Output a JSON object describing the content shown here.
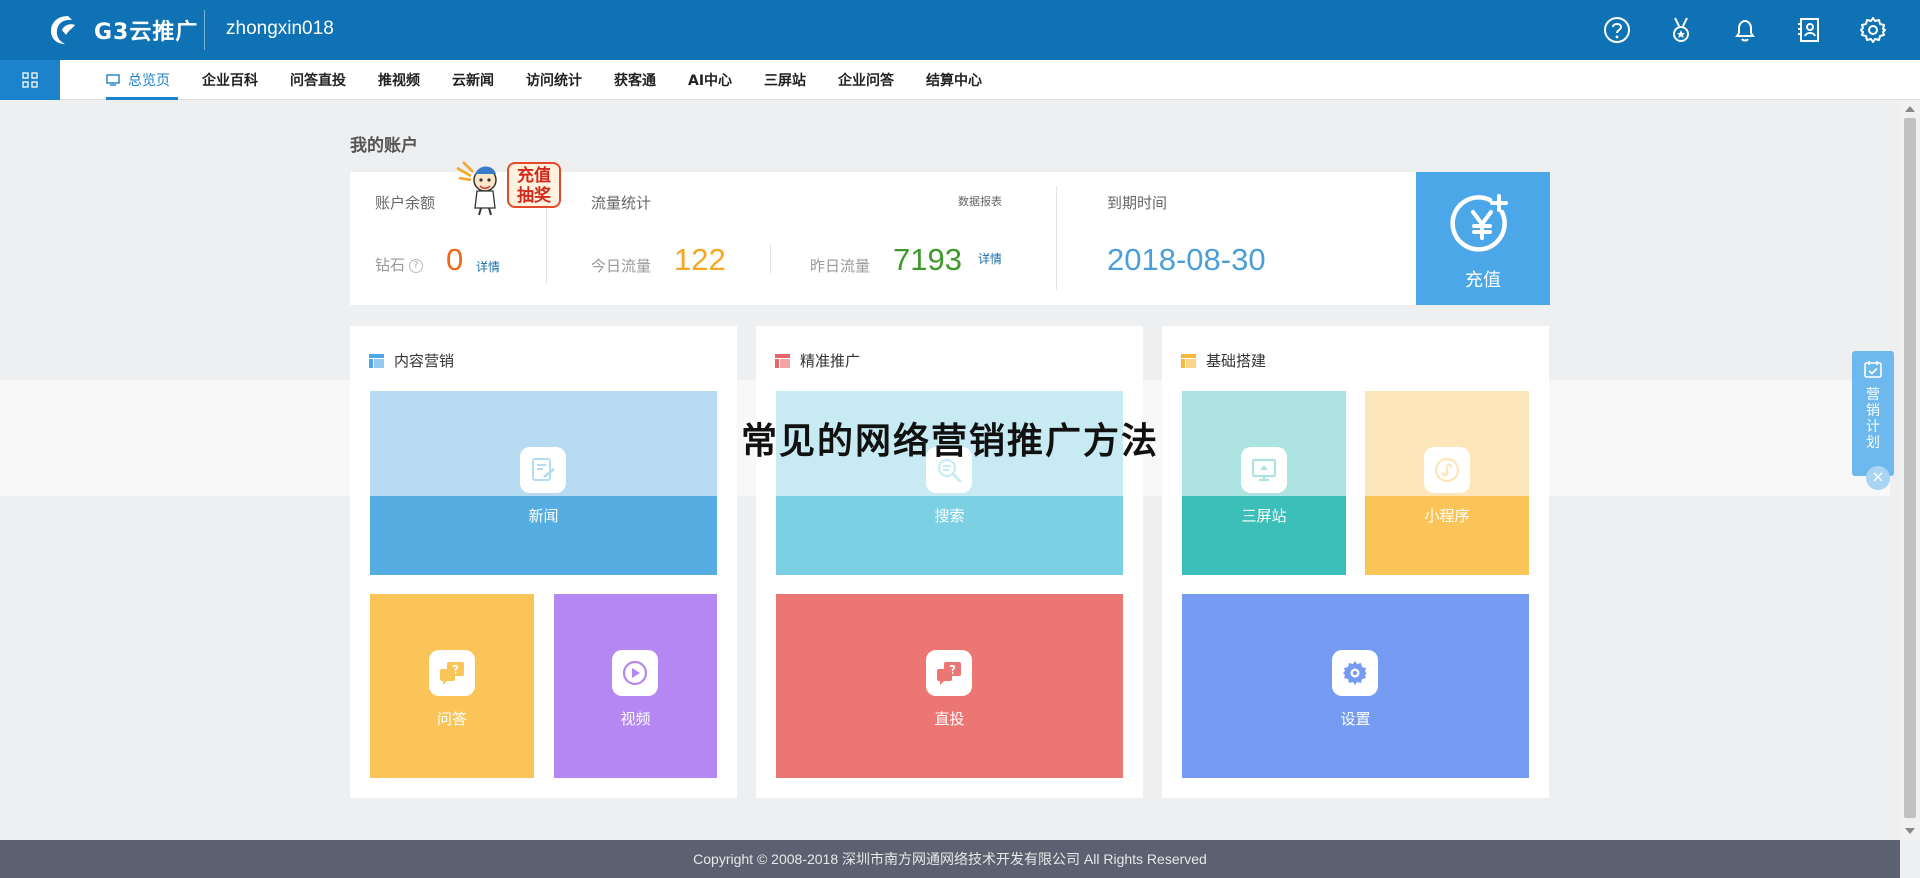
{
  "header": {
    "logo_text": "G3云推广",
    "username": "zhongxin018",
    "icons": [
      "help-icon",
      "medal-icon",
      "bell-icon",
      "contacts-icon",
      "gear-icon"
    ]
  },
  "nav": {
    "items": [
      {
        "label": "总览页",
        "active": true
      },
      {
        "label": "企业百科"
      },
      {
        "label": "问答直投"
      },
      {
        "label": "推视频"
      },
      {
        "label": "云新闻"
      },
      {
        "label": "访问统计"
      },
      {
        "label": "获客通"
      },
      {
        "label": "AI中心"
      },
      {
        "label": "三屏站"
      },
      {
        "label": "企业问答"
      },
      {
        "label": "结算中心"
      }
    ]
  },
  "account": {
    "section_title": "我的账户",
    "balance_label": "账户余额",
    "diamond_label": "钻石",
    "diamond_value": "0",
    "detail_link": "详情",
    "traffic_label": "流量统计",
    "report_link": "数据报表",
    "today_label": "今日流量",
    "today_value": "122",
    "yesterday_label": "昨日流量",
    "yesterday_value": "7193",
    "yesterday_detail": "详情",
    "expire_label": "到期时间",
    "expire_date": "2018-08-30",
    "recharge_label": "充值",
    "promo_text": "充值抽奖"
  },
  "panels": [
    {
      "title": "内容营销",
      "color": "#4ba7e8",
      "tiles": [
        {
          "label": "新闻",
          "icon": "news-icon",
          "color": "#55ade1"
        },
        {
          "label": "问答",
          "icon": "qa-icon",
          "color": "#fac458"
        },
        {
          "label": "视频",
          "icon": "video-play-icon",
          "color": "#b487f2"
        }
      ]
    },
    {
      "title": "精准推广",
      "color": "#e8666a",
      "tiles": [
        {
          "label": "搜索",
          "icon": "search-icon",
          "color": "#7cd0e3"
        },
        {
          "label": "直投",
          "icon": "direct-qa-icon",
          "color": "#ec7673"
        }
      ]
    },
    {
      "title": "基础搭建",
      "color": "#f5b83c",
      "tiles": [
        {
          "label": "三屏站",
          "icon": "monitor-icon",
          "color": "#3cbfb9"
        },
        {
          "label": "小程序",
          "icon": "mini-program-icon",
          "color": "#fac458"
        },
        {
          "label": "设置",
          "icon": "gear-icon",
          "color": "#759cf2"
        }
      ]
    }
  ],
  "banner": {
    "title": "常见的网络营销推广方法"
  },
  "side_float": {
    "label": "营销计划"
  },
  "footer": {
    "copyright": "Copyright © 2008-2018 深圳市南方网通网络技术开发有限公司 All Rights Reserved"
  }
}
